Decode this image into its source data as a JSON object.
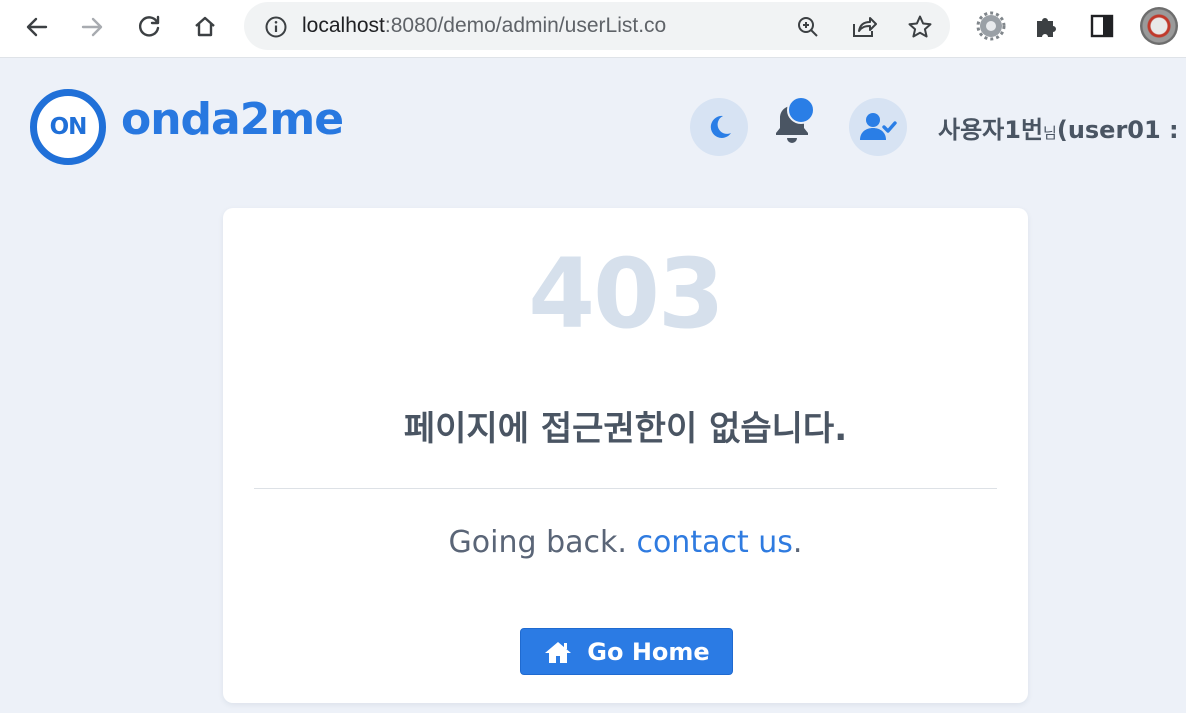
{
  "browser": {
    "url_host": "localhost",
    "url_rest": ":8080/demo/admin/userList.co"
  },
  "header": {
    "logo_mark": "ON",
    "logo_text": "onda2me",
    "user_name": "사용자1번",
    "user_honorific": "님",
    "user_id_prefix": "(user01 : "
  },
  "error": {
    "code": "403",
    "message": "페이지에 접근권한이 없습니다.",
    "sub_text": "Going back.",
    "contact_link": "contact us",
    "sub_end": ".",
    "button_label": "Go Home"
  },
  "colors": {
    "accent": "#2b7be4",
    "background": "#edf1f8",
    "code": "#d6e0ec",
    "text": "#4a5563"
  },
  "icons": [
    "back-arrow-icon",
    "forward-arrow-icon",
    "reload-icon",
    "home-icon",
    "info-icon",
    "zoom-icon",
    "share-icon",
    "star-icon",
    "gear-icon",
    "puzzle-icon",
    "side-panel-icon",
    "moon-icon",
    "bell-icon",
    "user-check-icon",
    "house-icon"
  ]
}
